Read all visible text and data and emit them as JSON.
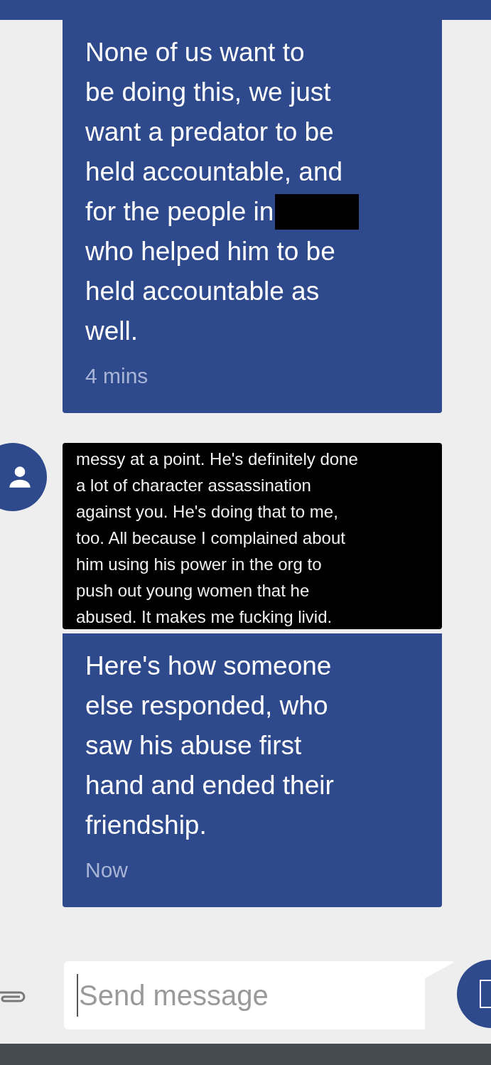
{
  "messages": [
    {
      "kind": "text",
      "lines": [
        {
          "text": "None of us want to",
          "redacted": false
        },
        {
          "text": "be doing this, we just",
          "redacted": false
        },
        {
          "text": "want a predator to be",
          "redacted": false
        },
        {
          "text": "held accountable, and",
          "redacted": false
        },
        {
          "text": "for the people in",
          "redacted": true
        },
        {
          "text": "who helped him to be",
          "redacted": false
        },
        {
          "text": "held accountable as",
          "redacted": false
        },
        {
          "text": "well.",
          "redacted": false
        }
      ],
      "time": "4 mins",
      "avatar": false
    },
    {
      "kind": "screenshot",
      "lines": [
        {
          "text": "messy at a point. He's definitely done",
          "redacted": false
        },
        {
          "text": "a lot of character assassination",
          "redacted": false
        },
        {
          "text": "against you. He's doing that to me,",
          "redacted": false
        },
        {
          "text": "too. All because I complained about",
          "redacted": false
        },
        {
          "text": "him using his power in the org to",
          "redacted": false
        },
        {
          "text": "push out young women that he",
          "redacted": false
        },
        {
          "text": "abused. It makes me fucking livid.",
          "redacted": false
        }
      ],
      "avatar": true
    },
    {
      "kind": "text",
      "lines": [
        {
          "text": "Here's how someone",
          "redacted": false
        },
        {
          "text": "else responded, who",
          "redacted": false
        },
        {
          "text": "saw his abuse first",
          "redacted": false
        },
        {
          "text": "hand and ended their",
          "redacted": false
        },
        {
          "text": "friendship.",
          "redacted": false
        }
      ],
      "time": "Now",
      "avatar": false
    }
  ],
  "composer": {
    "placeholder": "Send message"
  }
}
